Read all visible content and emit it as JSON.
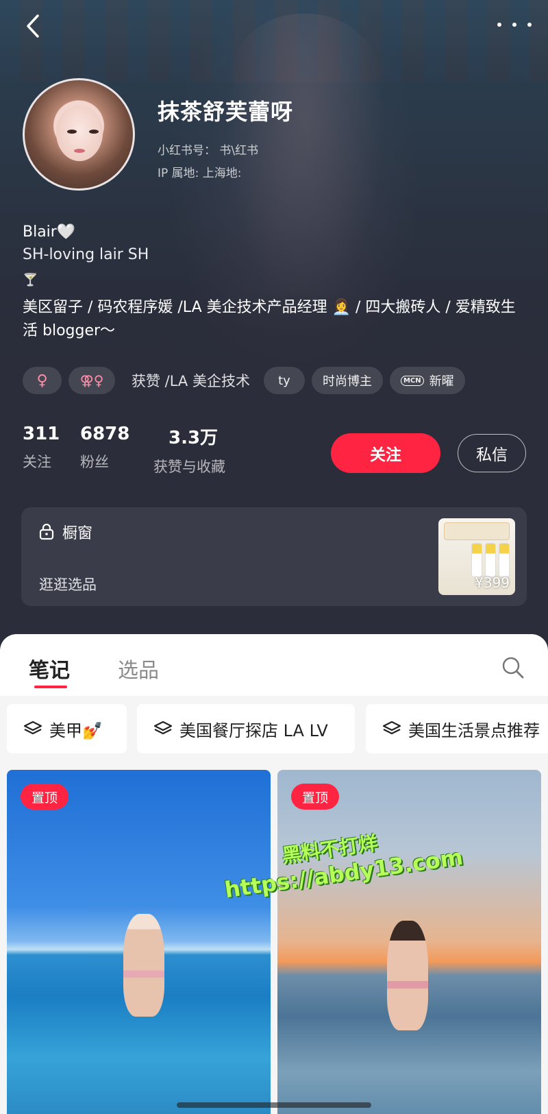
{
  "profile": {
    "nickname": "抹茶舒芙蕾呀",
    "red_id": "小红书号：  书\\红书",
    "ip_location": "IP 属地: 上海地:",
    "bio_name": "Blair🤍",
    "bio_sub": "SH-loving lair SH",
    "bio_icon": "🍸",
    "bio_desc": "美区留子 / 码农程序媛 /LA 美企技术产品经理 👩‍💼 / 四大搬砖人 / 爱精致生活 blogger～"
  },
  "tags": {
    "gender": "♀",
    "gender2": "⚢♀",
    "text_fragment": "获赞 /LA 美企技术",
    "short": "ty",
    "fashion": "时尚博主",
    "mcn_icon": "MCN",
    "mcn": "新曜"
  },
  "stats": {
    "following_num": "311",
    "following_label": "关注",
    "fans_num": "6878",
    "fans_label": "粉丝",
    "likes_num": "3.3万",
    "likes_label": "获赞与收藏"
  },
  "actions": {
    "follow": "关注",
    "message": "私信"
  },
  "shop": {
    "title": "橱窗",
    "subtitle": "逛逛选品",
    "price": "¥399"
  },
  "tabs": {
    "notes": "笔记",
    "picks": "选品"
  },
  "collections": [
    "美甲💅",
    "美国餐厅探店 LA LV",
    "美国生活景点推荐"
  ],
  "cards": [
    {
      "badge": "置顶"
    },
    {
      "badge": "置顶"
    }
  ],
  "watermark": {
    "line1": "黑料不打烊",
    "line2": "https://abdy13.com"
  },
  "colors": {
    "accent": "#ff2442",
    "dark_bg": "#2b2d3a"
  }
}
